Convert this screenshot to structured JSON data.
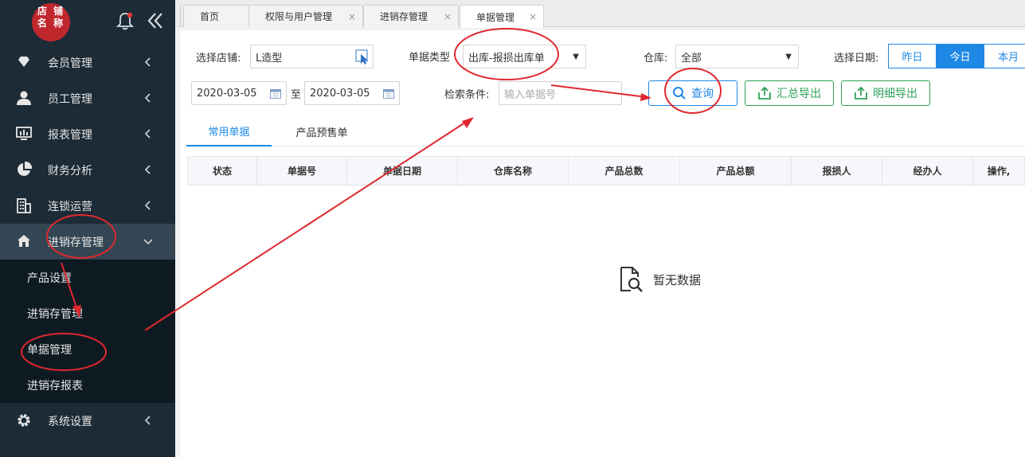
{
  "sidebar": {
    "logo_line1": "店 铺",
    "logo_line2": "名 称",
    "menu": [
      {
        "label": "会员管理"
      },
      {
        "label": "员工管理"
      },
      {
        "label": "报表管理"
      },
      {
        "label": "财务分析"
      },
      {
        "label": "连锁运营"
      },
      {
        "label": "进销存管理"
      },
      {
        "label": "系统设置"
      }
    ],
    "submenu": [
      {
        "label": "产品设置"
      },
      {
        "label": "进销存管理"
      },
      {
        "label": "单据管理"
      },
      {
        "label": "进销存报表"
      }
    ]
  },
  "tabs": [
    {
      "label": "首页"
    },
    {
      "label": "权限与用户管理",
      "close": "×"
    },
    {
      "label": "进销存管理",
      "close": "×"
    },
    {
      "label": "单据管理",
      "close": "×"
    }
  ],
  "filters": {
    "store_label": "选择店铺:",
    "store_value": "L造型",
    "doc_type_label": "单据类型",
    "doc_type_value": "出库-报损出库单",
    "warehouse_label": "仓库:",
    "warehouse_value": "全部",
    "date_label": "选择日期:",
    "date_options": [
      "昨日",
      "今日",
      "本月"
    ],
    "date_selected": "今日",
    "start_date": "2020-03-05",
    "to": "至",
    "end_date": "2020-03-05",
    "search_label": "检索条件:",
    "search_placeholder": "输入单据号"
  },
  "buttons": {
    "query": "查询",
    "summary_export": "汇总导出",
    "detail_export": "明细导出"
  },
  "subtabs": [
    {
      "label": "常用单据"
    },
    {
      "label": "产品预售单"
    }
  ],
  "table": {
    "columns": [
      "状态",
      "单据号",
      "单据日期",
      "仓库名称",
      "产品总数",
      "产品总额",
      "报损人",
      "经办人",
      "操作,"
    ]
  },
  "empty_text": "暂无数据",
  "colors": {
    "sidebar_bg": "#1c2b36",
    "accent_blue": "#1e88e5",
    "export_green": "#2fa05a",
    "annotation_red": "#e0282e"
  }
}
